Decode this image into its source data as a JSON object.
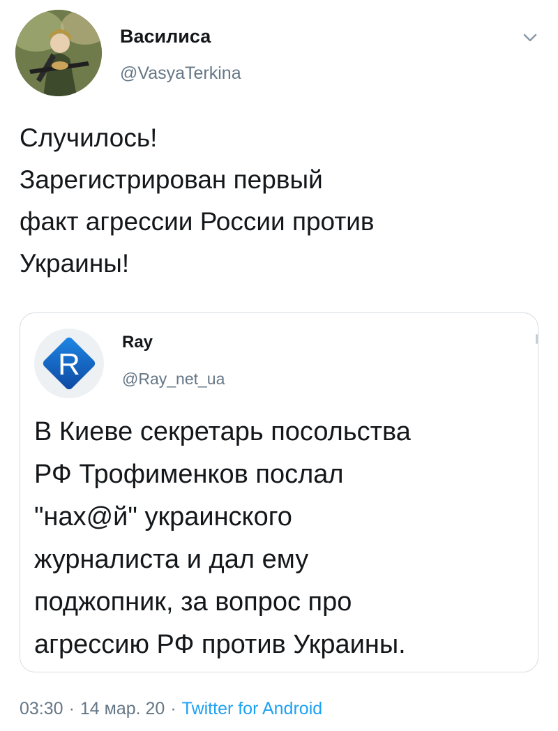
{
  "tweet": {
    "author_name": "Василиса",
    "author_handle": "@VasyaTerkina",
    "text_lines": [
      "Случилось!",
      "Зарегистрирован первый",
      "факт агрессии России против",
      "Украины!"
    ],
    "time": "03:30",
    "date": "14 мар. 20",
    "separator": "·",
    "source": "Twitter for Android",
    "menu_icon": "chevron-down-icon"
  },
  "quote": {
    "avatar_letter": "R",
    "author_name": "Ray",
    "author_handle": "@Ray_net_ua",
    "text_lines": [
      "В Киеве секретарь посольства",
      "РФ Трофименков послал",
      "\"нах@й\" украинского",
      "журналиста и дал ему",
      "поджопник, за вопрос про",
      "агрессию РФ против Украины."
    ]
  },
  "colors": {
    "text": "#14171a",
    "secondary": "#657786",
    "link": "#1da1f2",
    "border": "#d6dde2",
    "ray_logo_blue": "#1565c0"
  }
}
